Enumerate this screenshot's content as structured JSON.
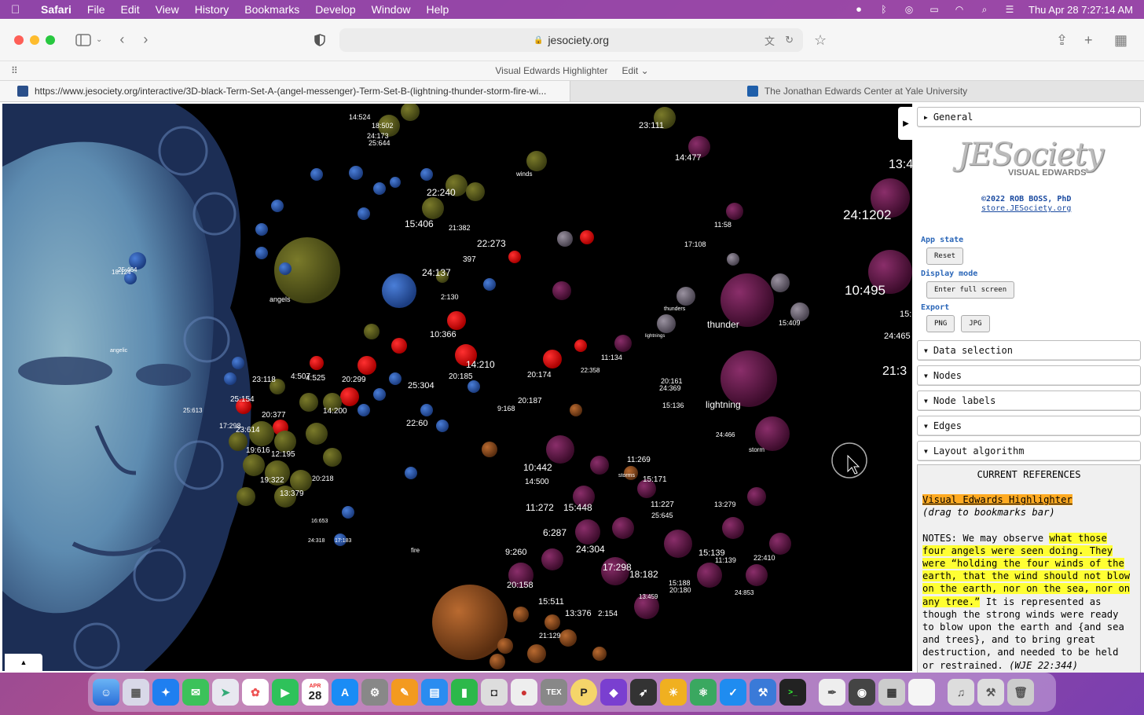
{
  "menubar": {
    "app_name": "Safari",
    "items": [
      "File",
      "Edit",
      "View",
      "History",
      "Bookmarks",
      "Develop",
      "Window",
      "Help"
    ],
    "clock": "Thu Apr 28  7:27:14 AM"
  },
  "toolbar": {
    "address": "jesociety.org",
    "page_title": "Visual Edwards Highlighter",
    "edit_menu": "Edit"
  },
  "tabs": [
    {
      "label": "https://www.jesociety.org/interactive/3D-black-Term-Set-A-(angel-messenger)-Term-Set-B-(lightning-thunder-storm-fire-wi..."
    },
    {
      "label": "The Jonathan Edwards Center at Yale University"
    }
  ],
  "viz": {
    "collapse_glyph": "▶",
    "bottom_glyph": "▲",
    "labels": [
      {
        "t": "14:524"
      },
      {
        "t": "18:502"
      },
      {
        "t": "24:173"
      },
      {
        "t": "25:644"
      },
      {
        "t": "23:111"
      },
      {
        "t": "14:477"
      },
      {
        "t": "winds"
      },
      {
        "t": "22:240"
      },
      {
        "t": "15:406"
      },
      {
        "t": "21:382"
      },
      {
        "t": "22:273"
      },
      {
        "t": "24:137"
      },
      {
        "t": "397"
      },
      {
        "t": "2:130"
      },
      {
        "t": "13:4"
      },
      {
        "t": "24:1202"
      },
      {
        "t": "11:58"
      },
      {
        "t": "17:108"
      },
      {
        "t": "10:495"
      },
      {
        "t": "thunder"
      },
      {
        "t": "15:409"
      },
      {
        "t": "24:465"
      },
      {
        "t": "21:3"
      },
      {
        "t": "15:"
      },
      {
        "t": "10:366"
      },
      {
        "t": "14:210"
      },
      {
        "t": "20:185"
      },
      {
        "t": "20:299"
      },
      {
        "t": "25:304"
      },
      {
        "t": "20:174"
      },
      {
        "t": "11:134"
      },
      {
        "t": "22:358"
      },
      {
        "t": "20:161"
      },
      {
        "t": "24:369"
      },
      {
        "t": "lightning"
      },
      {
        "t": "15:136"
      },
      {
        "t": "24:466"
      },
      {
        "t": "storm"
      },
      {
        "t": "25:154"
      },
      {
        "t": "23:118"
      },
      {
        "t": "4:507"
      },
      {
        "t": "4:525"
      },
      {
        "t": "20:377"
      },
      {
        "t": "14:200"
      },
      {
        "t": "22:60"
      },
      {
        "t": "20:187"
      },
      {
        "t": "9:168"
      },
      {
        "t": "23:614"
      },
      {
        "t": "19:616"
      },
      {
        "t": "12:195"
      },
      {
        "t": "19:322"
      },
      {
        "t": "13:379"
      },
      {
        "t": "20:218"
      },
      {
        "t": "11:269"
      },
      {
        "t": "10:442"
      },
      {
        "t": "14:500"
      },
      {
        "t": "15:171"
      },
      {
        "t": "11:272"
      },
      {
        "t": "15:448"
      },
      {
        "t": "11:227"
      },
      {
        "t": "25:645"
      },
      {
        "t": "13:279"
      },
      {
        "t": "6:287"
      },
      {
        "t": "9:260"
      },
      {
        "t": "24:304"
      },
      {
        "t": "15:139"
      },
      {
        "t": "11:139"
      },
      {
        "t": "22:410"
      },
      {
        "t": "17:298"
      },
      {
        "t": "18:182"
      },
      {
        "t": "15:188"
      },
      {
        "t": "20:180"
      },
      {
        "t": "20:158"
      },
      {
        "t": "15:511"
      },
      {
        "t": "13:376"
      },
      {
        "t": "2:154"
      },
      {
        "t": "21:129"
      },
      {
        "t": "24:853"
      },
      {
        "t": "fire"
      },
      {
        "t": "angels"
      },
      {
        "t": "25:464"
      },
      {
        "t": "18:124"
      },
      {
        "t": "angelic"
      },
      {
        "t": "25:613"
      },
      {
        "t": "17:298"
      },
      {
        "t": "24:318"
      },
      {
        "t": "16:653"
      },
      {
        "t": "17:183"
      },
      {
        "t": "thunders"
      },
      {
        "t": "lightnings"
      },
      {
        "t": "storms"
      },
      {
        "t": "13:459"
      }
    ]
  },
  "panel": {
    "folders_top": [
      "General"
    ],
    "logo_text": "JESociety",
    "logo_sub": "VISUAL EDWARDS",
    "copyright": "©2022 ROB BOSS, PhD",
    "store_link": "store.JESociety.org",
    "app_state_label": "App state",
    "reset_button": "Reset",
    "display_mode_label": "Display mode",
    "fullscreen_button": "Enter full screen",
    "export_label": "Export",
    "png_button": "PNG",
    "jpg_button": "JPG",
    "folders": [
      "Data selection",
      "Nodes",
      "Node labels",
      "Edges",
      "Layout algorithm"
    ],
    "refs": {
      "header": "CURRENT REFERENCES",
      "bookmarklet": "Visual Edwards Highlighter",
      "bookmarklet_note": "(drag to bookmarks bar)",
      "notes_prefix": "NOTES: We may observe ",
      "notes_hl": "what those four angels were seen doing. They were “holding the four winds of the earth, that the wind should not blow on the earth, nor on the sea, nor on any tree.”",
      "notes_rest": " It is represented as though the strong winds were ready to blow upon the earth and {and sea and trees}, and to bring great destruction, and needed to be held or restrained. ",
      "citation": "(WJE 22:344)"
    }
  },
  "dock": {
    "calendar_month": "APR",
    "calendar_day": "28",
    "tex_label": "TEX",
    "p_label": "P"
  }
}
